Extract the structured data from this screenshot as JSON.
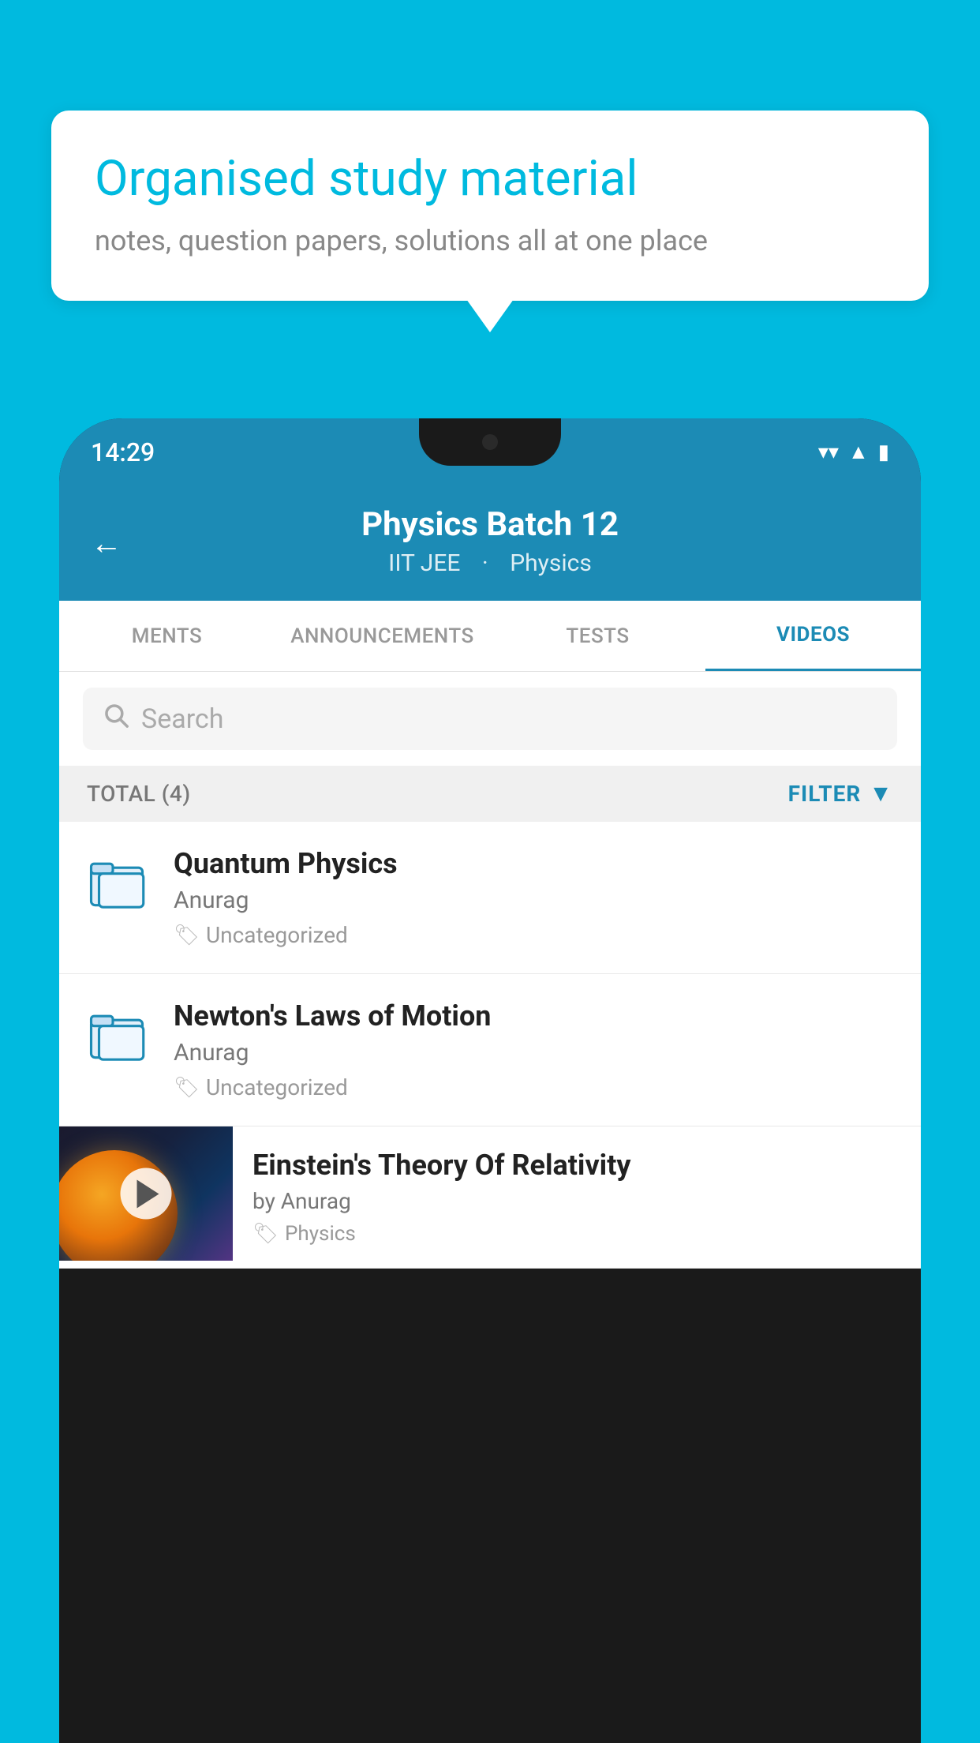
{
  "background_color": "#00BADF",
  "speech_bubble": {
    "title": "Organised study material",
    "subtitle": "notes, question papers, solutions all at one place"
  },
  "phone": {
    "status_bar": {
      "time": "14:29",
      "wifi": "▼",
      "signal": "▲",
      "battery": "▮"
    },
    "header": {
      "title": "Physics Batch 12",
      "subtitle_part1": "IIT JEE",
      "subtitle_part2": "Physics",
      "back_label": "←"
    },
    "tabs": [
      {
        "label": "MENTS",
        "active": false
      },
      {
        "label": "ANNOUNCEMENTS",
        "active": false
      },
      {
        "label": "TESTS",
        "active": false
      },
      {
        "label": "VIDEOS",
        "active": true
      }
    ],
    "search": {
      "placeholder": "Search"
    },
    "filter": {
      "total_label": "TOTAL (4)",
      "filter_label": "FILTER"
    },
    "videos": [
      {
        "title": "Quantum Physics",
        "author": "Anurag",
        "tag": "Uncategorized",
        "has_thumb": false
      },
      {
        "title": "Newton's Laws of Motion",
        "author": "Anurag",
        "tag": "Uncategorized",
        "has_thumb": false
      },
      {
        "title": "Einstein's Theory Of Relativity",
        "author": "by Anurag",
        "tag": "Physics",
        "has_thumb": true
      }
    ]
  }
}
